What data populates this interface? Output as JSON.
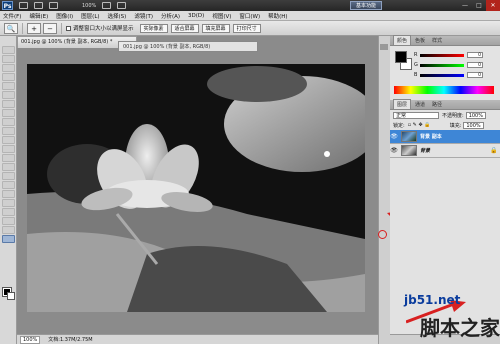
{
  "app": {
    "logo": "Ps",
    "zoom_readout": "100%",
    "workspace_button": "基本功能",
    "window_buttons": [
      "—",
      "□",
      "✕"
    ]
  },
  "menu": [
    "文件(F)",
    "编辑(E)",
    "图像(I)",
    "图层(L)",
    "选择(S)",
    "滤镜(T)",
    "分析(A)",
    "3D(D)",
    "视图(V)",
    "窗口(W)",
    "帮助(H)"
  ],
  "options": {
    "checkbox_label": "调整窗口大小以满屏显示",
    "btn_actual": "实际像素",
    "btn_fit": "适合屏幕",
    "btn_fill": "填充屏幕",
    "btn_print": "打印尺寸"
  },
  "document": {
    "tab_title": "001.jpg @ 100% (背景 副本, RGB/8) *",
    "float_tab_title": "001.jpg @ 100% (背景 副本, RGB/8)"
  },
  "status": {
    "zoom": "100%",
    "doc_info": "文档:1.37M/2.75M"
  },
  "color_panel": {
    "tabs": [
      "颜色",
      "色板",
      "样式"
    ],
    "sliders": [
      {
        "letter": "R",
        "value": "0",
        "color": "#d82020"
      },
      {
        "letter": "G",
        "value": "0",
        "color": "#20a020"
      },
      {
        "letter": "B",
        "value": "0",
        "color": "#2040d8"
      }
    ]
  },
  "layers_panel": {
    "tabs": [
      "图层",
      "通道",
      "路径"
    ],
    "blend_mode": "正常",
    "opacity_label": "不透明度:",
    "opacity_value": "100%",
    "lock_label": "锁定:",
    "fill_label": "填充:",
    "fill_value": "100%",
    "layers": [
      {
        "name": "背景 副本",
        "selected": true
      },
      {
        "name": "背景",
        "selected": false,
        "locked": true
      }
    ]
  },
  "watermark": {
    "site": "jb51.net",
    "name": "脚本之家"
  },
  "colors": {
    "selected_layer": "#3e86d6",
    "annotation_red": "#d82020"
  }
}
